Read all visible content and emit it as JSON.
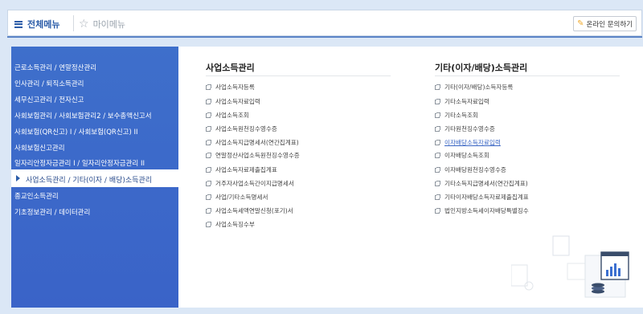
{
  "header": {
    "all_menu_label": "전체메뉴",
    "my_menu_label": "마이메뉴",
    "inquiry_label": "온라인 문의하기"
  },
  "sidebar": {
    "items": [
      {
        "label": "근로소득관리 / 연말정산관리"
      },
      {
        "label": "인사관리 / 퇴직소득관리"
      },
      {
        "label": "세무신고관리 / 전자신고"
      },
      {
        "label": "사회보험관리 / 사회보험관리2 / 보수총액신고서"
      },
      {
        "label": "사회보험(QR신고) I / 사회보험(QR신고) II"
      },
      {
        "label": "사회보험신고관리"
      },
      {
        "label": "일자리안정자금관리 I / 일자리안정자금관리 II"
      },
      {
        "label": "사업소득관리 / 기타(이자 / 배당)소득관리"
      },
      {
        "label": "종교인소득관리"
      },
      {
        "label": "기초정보관리 / 데이터관리"
      }
    ],
    "active_index": 7
  },
  "business_income": {
    "title": "사업소득관리",
    "links": [
      "사업소득자등록",
      "사업소득자료입력",
      "사업소득조회",
      "사업소득원천징수영수증",
      "사업소득지급명세서(연간집계표)",
      "연말정산사업소득원천징수영수증",
      "사업소득자료제출집계표",
      "거주자사업소득간이지급명세서",
      "사업/기타소득명세서",
      "사업소득세액연말신청(포기)서",
      "사업소득징수부"
    ]
  },
  "other_income": {
    "title": "기타(이자/배당)소득관리",
    "links": [
      "기타(이자/배당)소득자등록",
      "기타소득자료입력",
      "기타소득조회",
      "기타원천징수영수증",
      "이자배당소득자료입력",
      "이자배당소득조회",
      "이자배당원천징수영수증",
      "기타소득지급명세서(연간집계표)",
      "기타이자배당소득자료제출집계표",
      "법인지방소득세이자배당특별징수"
    ],
    "highlighted_index": 4
  },
  "colors": {
    "sidebar_bg": "#3d6bca",
    "accent": "#2b5ca8",
    "link_highlight": "#3a66c4"
  }
}
